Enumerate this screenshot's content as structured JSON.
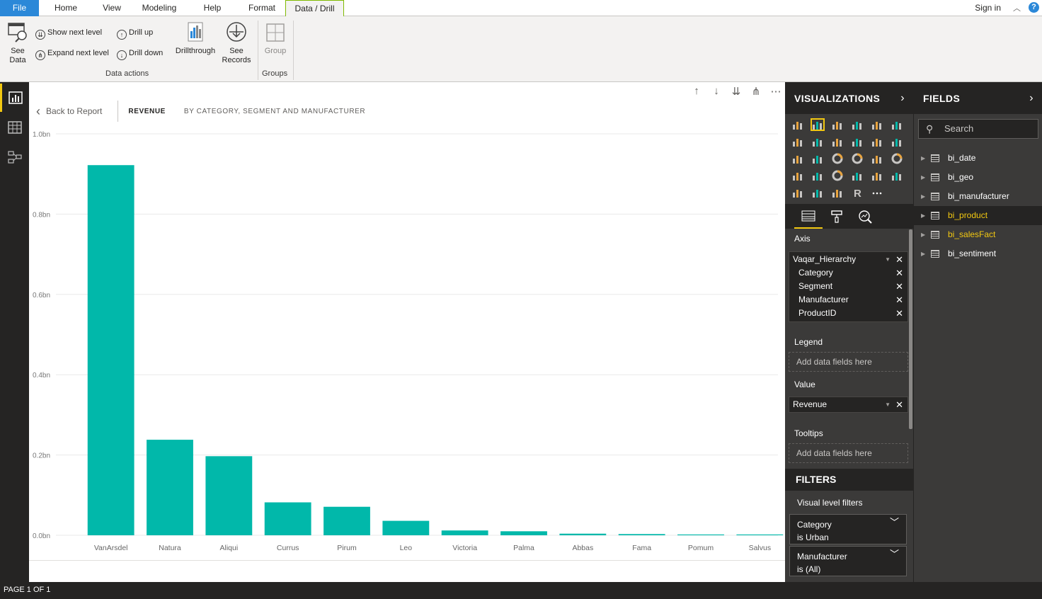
{
  "tabs": [
    "File",
    "Home",
    "View",
    "Modeling",
    "Help",
    "Format",
    "Data / Drill"
  ],
  "active_tab": "Data / Drill",
  "signin": "Sign in",
  "ribbon": {
    "see_data_line1": "See",
    "see_data_line2": "Data",
    "show_next_level": "Show next level",
    "expand_next_level": "Expand next level",
    "drill_up": "Drill up",
    "drill_down": "Drill down",
    "drillthrough": "Drillthrough",
    "see_records_line1": "See",
    "see_records_line2": "Records",
    "group": "Group",
    "group_data_actions": "Data actions",
    "group_groups": "Groups"
  },
  "visual": {
    "back_label": "Back to Report",
    "title": "REVENUE",
    "subtitle": "BY CATEGORY, SEGMENT AND MANUFACTURER"
  },
  "chart_data": {
    "type": "bar",
    "categories": [
      "VanArsdel",
      "Natura",
      "Aliqui",
      "Currus",
      "Pirum",
      "Leo",
      "Victoria",
      "Palma",
      "Abbas",
      "Fama",
      "Pomum",
      "Salvus"
    ],
    "values": [
      0.922,
      0.238,
      0.197,
      0.082,
      0.071,
      0.036,
      0.012,
      0.01,
      0.004,
      0.003,
      0.002,
      0.002
    ],
    "ylim": [
      0,
      1.0
    ],
    "yticks": [
      "0.0bn",
      "0.2bn",
      "0.4bn",
      "0.6bn",
      "0.8bn",
      "1.0bn"
    ],
    "ytick_values": [
      0,
      0.2,
      0.4,
      0.6,
      0.8,
      1.0
    ],
    "color": "#01b8aa",
    "grid": true
  },
  "visualizations": {
    "title": "VISUALIZATIONS",
    "wells": {
      "axis_label": "Axis",
      "axis_items": [
        "Vaqar_Hierarchy",
        "Category",
        "Segment",
        "Manufacturer",
        "ProductID"
      ],
      "legend_label": "Legend",
      "legend_placeholder": "Add data fields here",
      "value_label": "Value",
      "value_item": "Revenue",
      "tooltips_label": "Tooltips",
      "tooltips_placeholder": "Add data fields here"
    },
    "filters_title": "FILTERS",
    "visual_level_filters": "Visual level filters",
    "filters": [
      {
        "field": "Category",
        "state": "is Urban"
      },
      {
        "field": "Manufacturer",
        "state": "is (All)"
      }
    ]
  },
  "fields_pane": {
    "title": "FIELDS",
    "search_placeholder": "Search",
    "tables": [
      "bi_date",
      "bi_geo",
      "bi_manufacturer",
      "bi_product",
      "bi_salesFact",
      "bi_sentiment"
    ]
  },
  "status": "PAGE 1 OF 1",
  "colors": {
    "accent": "#f2c811",
    "bar": "#01b8aa",
    "file_tab": "#2b88d8"
  }
}
